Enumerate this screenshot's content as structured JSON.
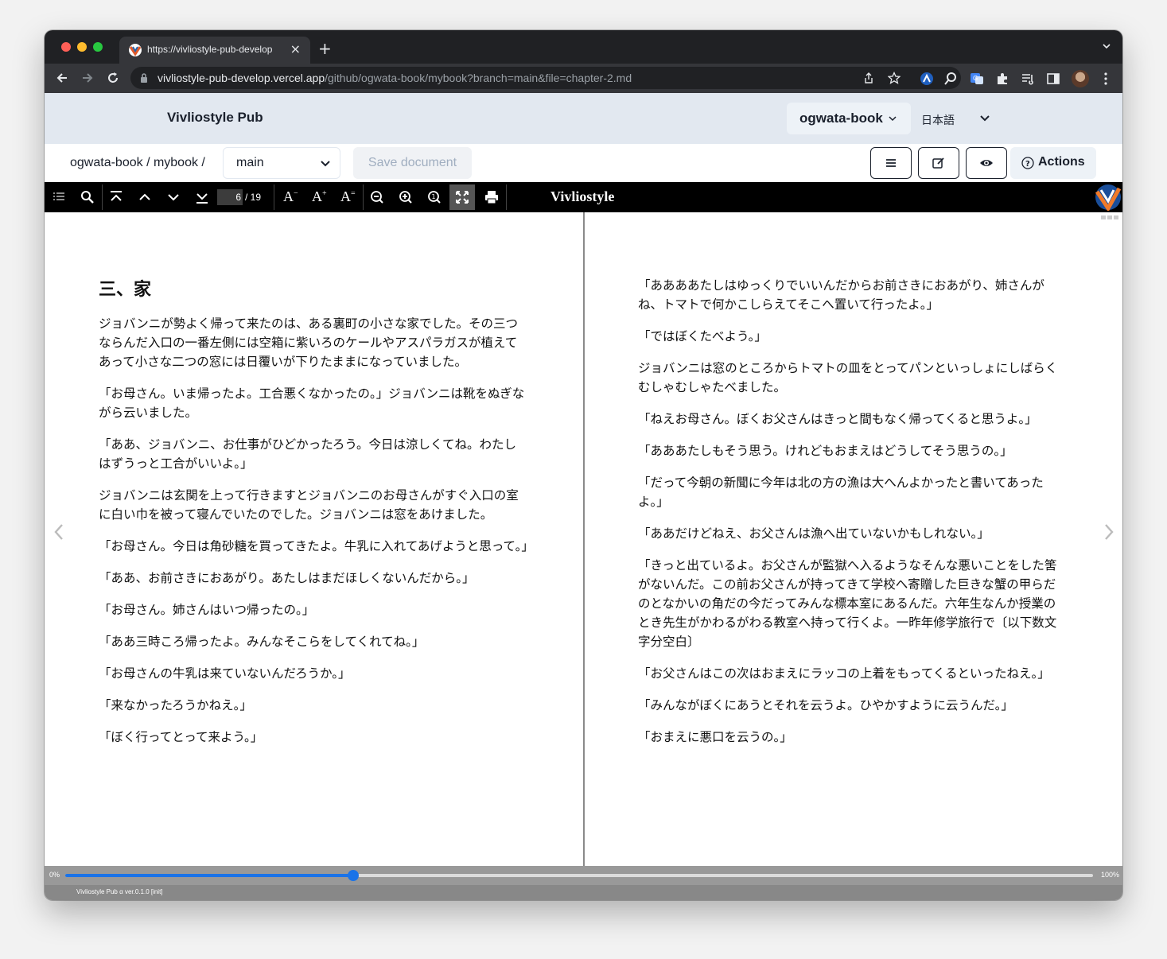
{
  "browser": {
    "tab_title": "https://vivliostyle-pub-develop",
    "url_host": "vivliostyle-pub-develop.vercel.app",
    "url_path": "/github/ogwata-book/mybook?branch=main&file=chapter-2.md",
    "colors": {
      "tabstrip": "#202124",
      "toolbar": "#35363a"
    }
  },
  "app": {
    "brand": "Vivliostyle Pub",
    "owner": "ogwata-book",
    "language": "日本語",
    "breadcrumb": "ogwata-book / mybook /",
    "branch": "main",
    "save_label": "Save document",
    "actions_label": "Actions"
  },
  "viewer": {
    "current_page": "6",
    "total_pages": "/ 19",
    "title": "Vivliostyle",
    "progress": {
      "min_label": "0%",
      "max_label": "100%",
      "value": 0.28
    },
    "version": "Vivliostyle Pub α ver.0.1.0 [init]"
  },
  "left_page": {
    "heading": "三、家",
    "paragraphs": [
      "ジョバンニが勢よく帰って来たのは、ある裏町の小さな家でした。その三つならんだ入口の一番左側には空箱に紫いろのケールやアスパラガスが植えてあって小さな二つの窓には日覆いが下りたままになっていました。",
      "「お母さん。いま帰ったよ。工合悪くなかったの。」ジョバンニは靴をぬぎながら云いました。",
      "「ああ、ジョバンニ、お仕事がひどかったろう。今日は涼しくてね。わたしはずうっと工合がいいよ。」",
      "ジョバンニは玄関を上って行きますとジョバンニのお母さんがすぐ入口の室に白い巾を被って寝んでいたのでした。ジョバンニは窓をあけました。",
      "「お母さん。今日は角砂糖を買ってきたよ。牛乳に入れてあげようと思って。」",
      "「ああ、お前さきにおあがり。あたしはまだほしくないんだから。」",
      "「お母さん。姉さんはいつ帰ったの。」",
      "「ああ三時ころ帰ったよ。みんなそこらをしてくれてね。」",
      "「お母さんの牛乳は来ていないんだろうか。」",
      "「来なかったろうかねえ。」",
      "「ぼく行ってとって来よう。」"
    ]
  },
  "right_page": {
    "paragraphs": [
      "「ああああたしはゆっくりでいいんだからお前さきにおあがり、姉さんがね、トマトで何かこしらえてそこへ置いて行ったよ。」",
      "「ではぼくたべよう。」",
      "ジョバンニは窓のところからトマトの皿をとってパンといっしょにしばらくむしゃむしゃたべました。",
      "「ねえお母さん。ぼくお父さんはきっと間もなく帰ってくると思うよ。」",
      "「あああたしもそう思う。けれどもおまえはどうしてそう思うの。」",
      "「だって今朝の新聞に今年は北の方の漁は大へんよかったと書いてあったよ。」",
      "「ああだけどねえ、お父さんは漁へ出ていないかもしれない。」",
      "「きっと出ているよ。お父さんが監獄へ入るようなそんな悪いことをした筈がないんだ。この前お父さんが持ってきて学校へ寄贈した巨きな蟹の甲らだのとなかいの角だの今だってみんな標本室にあるんだ。六年生なんか授業のとき先生がかわるがわる教室へ持って行くよ。一昨年修学旅行で〔以下数文字分空白〕",
      "「お父さんはこの次はおまえにラッコの上着をもってくるといったねえ。」",
      "「みんながぼくにあうとそれを云うよ。ひやかすように云うんだ。」",
      "「おまえに悪口を云うの。」"
    ]
  }
}
